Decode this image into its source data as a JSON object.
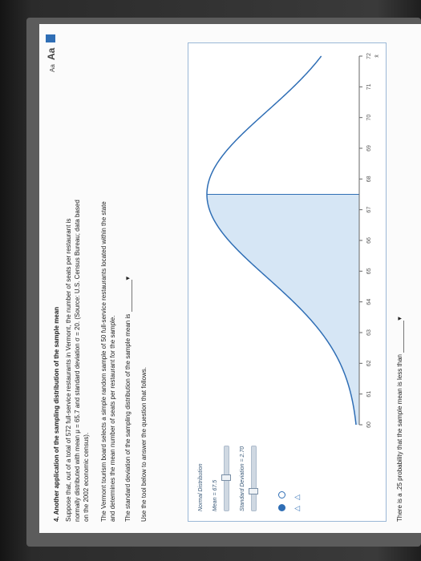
{
  "text_size_small": "Aa",
  "text_size_large": "Aa",
  "question_title": "4. Another application of the sampling distribution of the sample mean",
  "para1": [
    "Suppose that, out of a total of 572 full-service restaurants in Vermont, the number of seats per restaurant is",
    "normally distributed with mean μ = 65.7 and standard deviation σ = 20. (Source: U.S. Census Bureau; data based",
    "on the 2002 economic census)."
  ],
  "para2": [
    "The Vermont tourism board selects a simple random sample of 50 full-service restaurants located within the state",
    "and determines the mean number of seats per restaurant for the sample."
  ],
  "para3": "The standard deviation of the sampling distribution of the sample mean is",
  "para4": "Use the tool below to answer the question that follows.",
  "tool": {
    "title": "Normal Distribution",
    "mean_label": "Mean = 67.5",
    "sd_label": "Standard Deviation = 2.70",
    "mean_value": 67.5,
    "sd_value": 2.7,
    "mean_range": [
      50,
      85
    ],
    "sd_range": [
      0,
      10
    ],
    "accent": "#2f6eb5",
    "chart_data": {
      "type": "area",
      "x_ticks": [
        "60",
        "61",
        "62",
        "63",
        "64",
        "65",
        "66",
        "67",
        "68",
        "69",
        "70",
        "71",
        "72"
      ],
      "xlabel": "x̄",
      "xlim": [
        60,
        72
      ],
      "mean": 67.5,
      "sd": 2.7,
      "shaded_to": 67.5
    }
  },
  "answer_text": "There is a .25 probability that the sample mean is less than"
}
